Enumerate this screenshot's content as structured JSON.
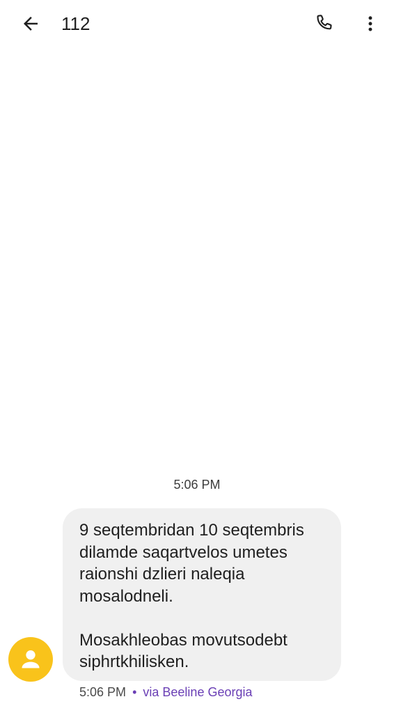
{
  "header": {
    "title": "112",
    "back_icon": "arrow-left-icon",
    "call_icon": "phone-icon",
    "more_icon": "more-vert-icon"
  },
  "conversation": {
    "timestamp": "5:06 PM",
    "message": {
      "text": "9 seqtembridan 10 seqtembris dilamde saqartvelos umetes raionshi dzlieri naleqia mosalodneli.\n\nMosakhleobas movutsodebt siphrtkhilisken.",
      "time": "5:06 PM",
      "separator": "•",
      "via": "via Beeline Georgia"
    },
    "avatar_icon": "person-icon"
  },
  "colors": {
    "avatar_bg": "#f9c31b",
    "bubble_bg": "#f0f0f0",
    "accent": "#6a3fb5"
  }
}
